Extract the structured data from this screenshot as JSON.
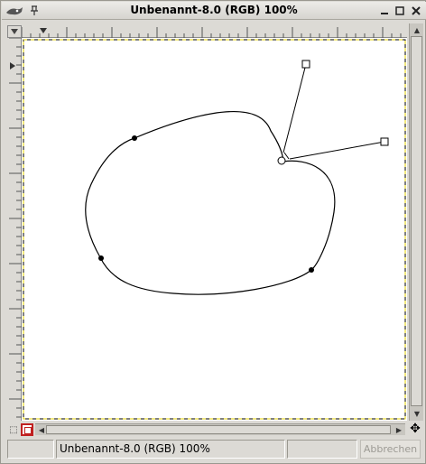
{
  "window": {
    "title": "Unbenannt-8.0 (RGB) 100%",
    "icons": {
      "app": "gimp-wilber-icon",
      "pin": "pin-icon",
      "minimize": "minimize-icon",
      "maximize": "maximize-icon",
      "close": "close-icon"
    }
  },
  "glyphs": {
    "app": "⚬",
    "pin": "⊥",
    "minimize": "▁",
    "maximize": "□",
    "close": "✕",
    "arrow_up": "▲",
    "arrow_down": "▼",
    "arrow_left": "◀",
    "arrow_right": "▶",
    "qmask": "⬚",
    "navigate": "✥"
  },
  "statusbar": {
    "coords": "",
    "title": "Unbenannt-8.0 (RGB) 100%",
    "progress": "",
    "cancel_label": "Abbrechen",
    "cancel_enabled": false
  },
  "canvas": {
    "background": "#ffffff",
    "selection_border": "#e6d200",
    "path_color": "#000000",
    "tool": "paths"
  },
  "colors": {
    "chrome": "#dcdad5",
    "accent_red": "#c02020"
  }
}
